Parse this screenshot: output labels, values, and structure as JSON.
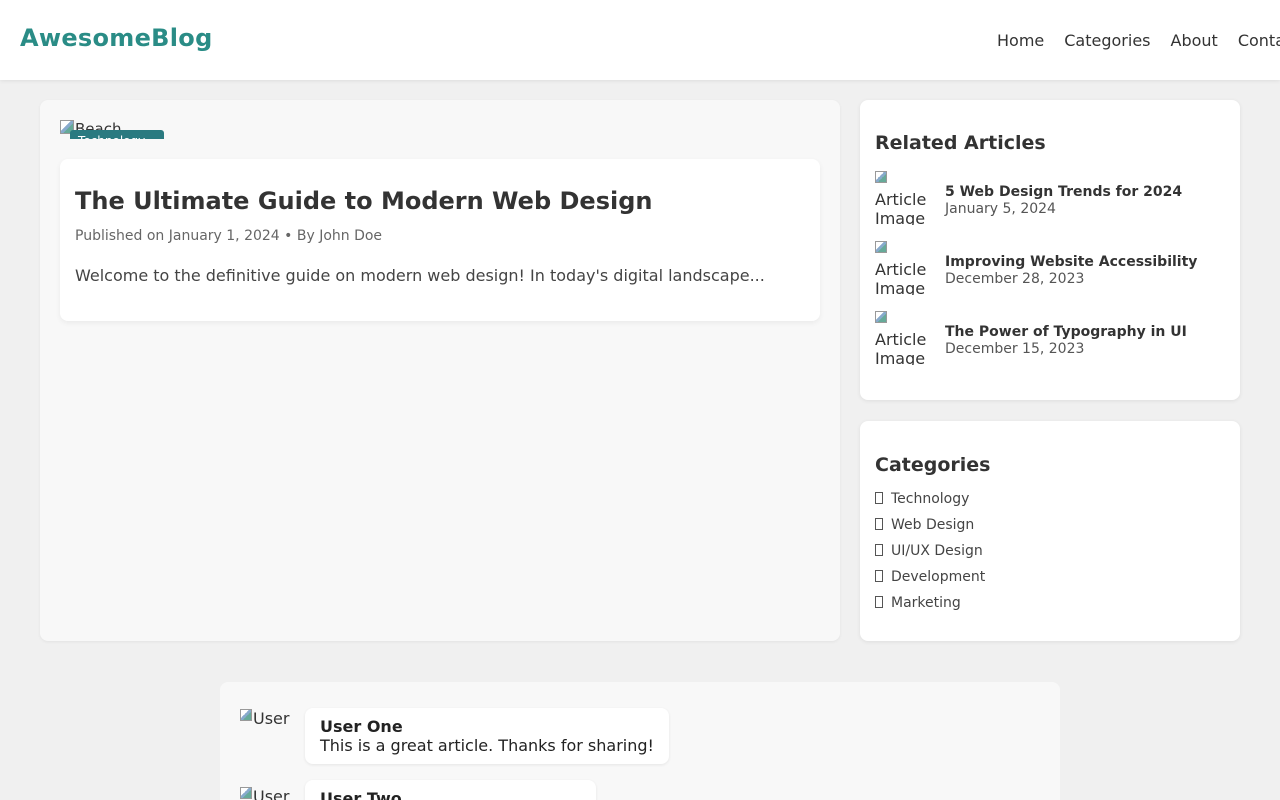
{
  "header": {
    "logo": "AwesomeBlog",
    "nav": [
      "Home",
      "Categories",
      "About",
      "Contact"
    ]
  },
  "article": {
    "hero_alt": "Beach",
    "badge": "Technology",
    "title": "The Ultimate Guide to Modern Web Design",
    "meta": "Published on January 1, 2024 • By John Doe",
    "excerpt": "Welcome to the definitive guide on modern web design! In today's digital landscape..."
  },
  "related": {
    "title": "Related Articles",
    "thumb_alt": "Article Image",
    "items": [
      {
        "title": "5 Web Design Trends for 2024",
        "date": "January 5, 2024"
      },
      {
        "title": "Improving Website Accessibility",
        "date": "December 28, 2023"
      },
      {
        "title": "The Power of Typography in UI",
        "date": "December 15, 2023"
      }
    ]
  },
  "categories": {
    "title": "Categories",
    "items": [
      "Technology",
      "Web Design",
      "UI/UX Design",
      "Development",
      "Marketing"
    ]
  },
  "comments": {
    "avatar_alt": "User",
    "items": [
      {
        "name": "User One",
        "text": "This is a great article. Thanks for sharing!"
      },
      {
        "name": "User Two",
        "text": ""
      }
    ]
  },
  "colors": {
    "brand": "#2a8c86",
    "badge": "#2a7a80",
    "page_bg": "#f0f0f0"
  }
}
